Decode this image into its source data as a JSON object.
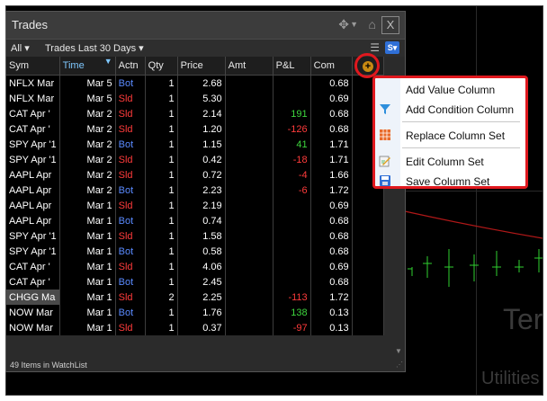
{
  "panel": {
    "title": "Trades",
    "close_label": "X",
    "filter_all": "All ▾",
    "filter_period": "Trades Last 30 Days ▾",
    "s_button": "S▾",
    "status": "49 Items in WatchList"
  },
  "background": {
    "word1": "Ter",
    "word2": "Utilities"
  },
  "columns": [
    "Sym",
    "Time",
    "Actn",
    "Qty",
    "Price",
    "Amt",
    "P&L",
    "Com"
  ],
  "sorted_column": "Time",
  "rows": [
    {
      "sym": "NFLX Mar",
      "time": "Mar 5",
      "actn": "Bot",
      "qty": "1",
      "price": "2.68",
      "amt": "",
      "pnl": "",
      "com": "0.68"
    },
    {
      "sym": "NFLX Mar",
      "time": "Mar 5",
      "actn": "Sld",
      "qty": "1",
      "price": "5.30",
      "amt": "",
      "pnl": "",
      "com": "0.69"
    },
    {
      "sym": "CAT Apr '",
      "time": "Mar 2",
      "actn": "Sld",
      "qty": "1",
      "price": "2.14",
      "amt": "",
      "pnl": "191",
      "com": "0.68"
    },
    {
      "sym": "CAT Apr '",
      "time": "Mar 2",
      "actn": "Sld",
      "qty": "1",
      "price": "1.20",
      "amt": "",
      "pnl": "-126",
      "com": "0.68"
    },
    {
      "sym": "SPY Apr '1",
      "time": "Mar 2",
      "actn": "Bot",
      "qty": "1",
      "price": "1.15",
      "amt": "",
      "pnl": "41",
      "com": "1.71"
    },
    {
      "sym": "SPY Apr '1",
      "time": "Mar 2",
      "actn": "Sld",
      "qty": "1",
      "price": "0.42",
      "amt": "",
      "pnl": "-18",
      "com": "1.71"
    },
    {
      "sym": "AAPL Apr",
      "time": "Mar 2",
      "actn": "Sld",
      "qty": "1",
      "price": "0.72",
      "amt": "",
      "pnl": "-4",
      "com": "1.66"
    },
    {
      "sym": "AAPL Apr",
      "time": "Mar 2",
      "actn": "Bot",
      "qty": "1",
      "price": "2.23",
      "amt": "",
      "pnl": "-6",
      "com": "1.72"
    },
    {
      "sym": "AAPL Apr",
      "time": "Mar 1",
      "actn": "Sld",
      "qty": "1",
      "price": "2.19",
      "amt": "",
      "pnl": "",
      "com": "0.69"
    },
    {
      "sym": "AAPL Apr",
      "time": "Mar 1",
      "actn": "Bot",
      "qty": "1",
      "price": "0.74",
      "amt": "",
      "pnl": "",
      "com": "0.68"
    },
    {
      "sym": "SPY Apr '1",
      "time": "Mar 1",
      "actn": "Sld",
      "qty": "1",
      "price": "1.58",
      "amt": "",
      "pnl": "",
      "com": "0.68"
    },
    {
      "sym": "SPY Apr '1",
      "time": "Mar 1",
      "actn": "Bot",
      "qty": "1",
      "price": "0.58",
      "amt": "",
      "pnl": "",
      "com": "0.68"
    },
    {
      "sym": "CAT Apr '",
      "time": "Mar 1",
      "actn": "Sld",
      "qty": "1",
      "price": "4.06",
      "amt": "",
      "pnl": "",
      "com": "0.69"
    },
    {
      "sym": "CAT Apr '",
      "time": "Mar 1",
      "actn": "Bot",
      "qty": "1",
      "price": "2.45",
      "amt": "",
      "pnl": "",
      "com": "0.68"
    },
    {
      "sym": "CHGG Ma",
      "time": "Mar 1",
      "actn": "Sld",
      "qty": "2",
      "price": "2.25",
      "amt": "",
      "pnl": "-113",
      "com": "1.72"
    },
    {
      "sym": "NOW Mar",
      "time": "Mar 1",
      "actn": "Bot",
      "qty": "1",
      "price": "1.76",
      "amt": "",
      "pnl": "138",
      "com": "0.13"
    },
    {
      "sym": "NOW Mar",
      "time": "Mar 1",
      "actn": "Sld",
      "qty": "1",
      "price": "0.37",
      "amt": "",
      "pnl": "-97",
      "com": "0.13"
    }
  ],
  "context_menu": {
    "items": [
      {
        "label": "Add Value Column",
        "icon": "none"
      },
      {
        "label": "Add Condition Column",
        "icon": "filter-icon"
      },
      {
        "label": "Replace Column Set",
        "icon": "grid-icon"
      },
      {
        "label": "Edit Column Set",
        "icon": "edit-icon"
      },
      {
        "label": "Save Column Set",
        "icon": "save-icon"
      }
    ]
  },
  "colors": {
    "bot": "#5a8aff",
    "sld": "#ff3b3b",
    "positive": "#3ed63e",
    "negative": "#ff3b3b",
    "highlight": "#e0181e"
  }
}
